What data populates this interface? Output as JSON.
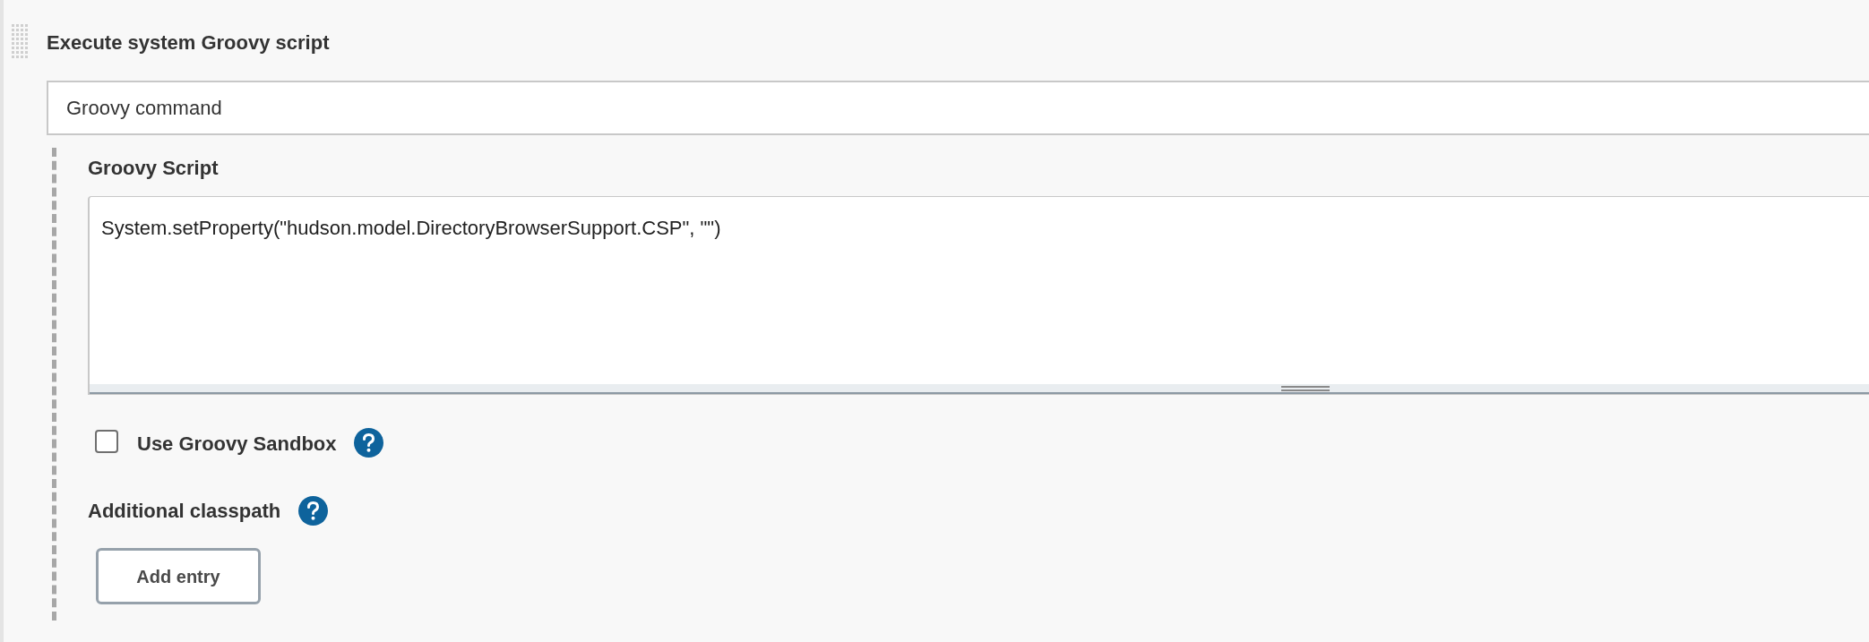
{
  "section": {
    "title": "Execute system Groovy script"
  },
  "source_select": {
    "value": "Groovy command"
  },
  "script": {
    "label": "Groovy Script",
    "value": "System.setProperty(\"hudson.model.DirectoryBrowserSupport.CSP\", \"\")"
  },
  "sandbox": {
    "label": "Use Groovy Sandbox",
    "checked": false
  },
  "classpath": {
    "label": "Additional classpath",
    "button": "Add entry"
  }
}
